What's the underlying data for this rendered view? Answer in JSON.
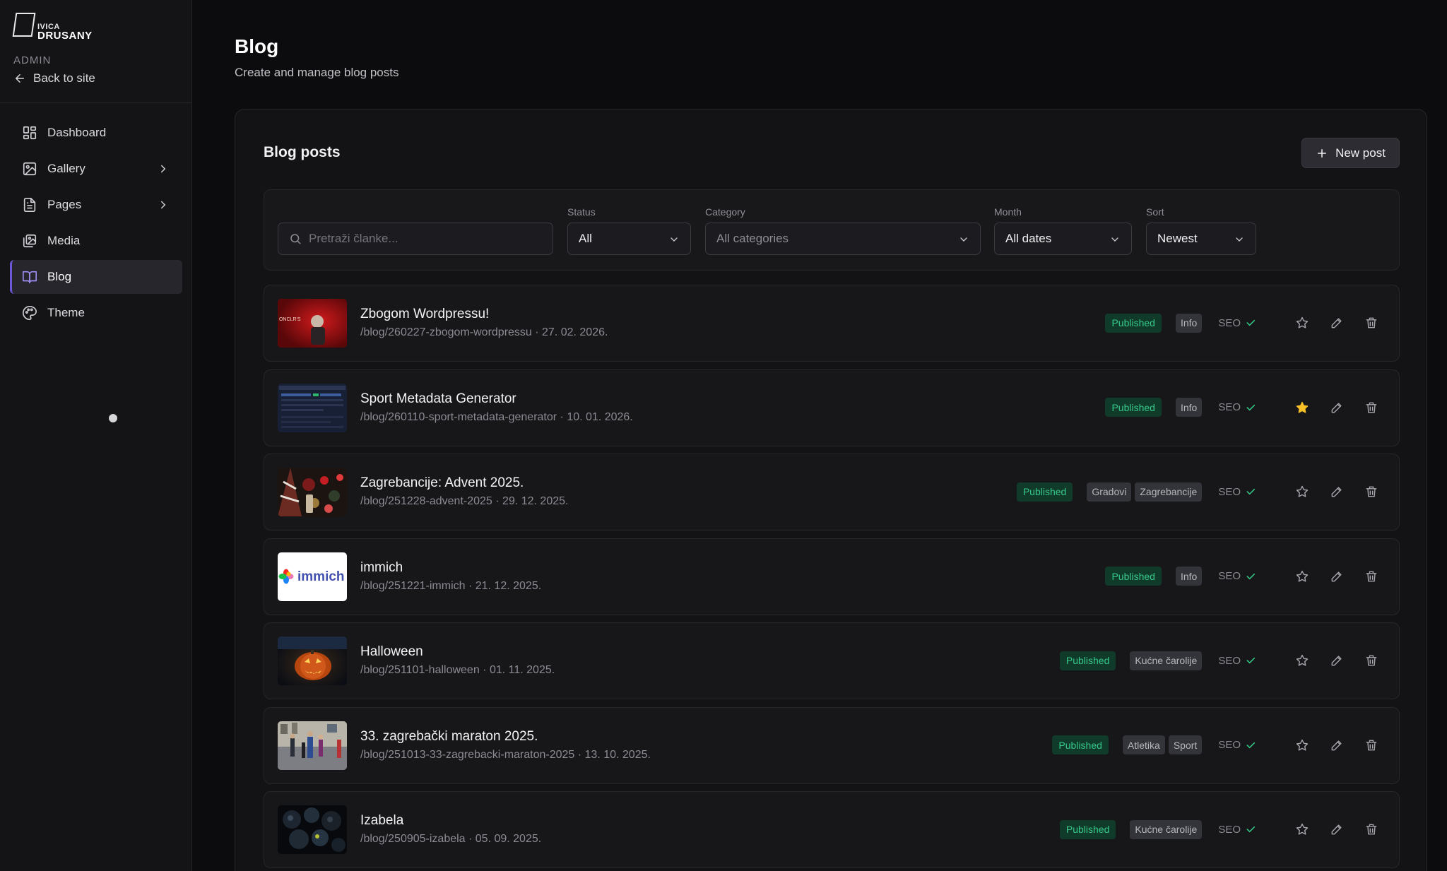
{
  "sidebar": {
    "logo_line1": "IVICA",
    "logo_line2": "DRUSANY",
    "section_label": "ADMIN",
    "back_label": "Back to site",
    "items": [
      {
        "label": "Dashboard",
        "icon": "dashboard-icon",
        "active": false,
        "has_submenu": false
      },
      {
        "label": "Gallery",
        "icon": "image-icon",
        "active": false,
        "has_submenu": true
      },
      {
        "label": "Pages",
        "icon": "file-icon",
        "active": false,
        "has_submenu": true
      },
      {
        "label": "Media",
        "icon": "images-icon",
        "active": false,
        "has_submenu": false
      },
      {
        "label": "Blog",
        "icon": "book-icon",
        "active": true,
        "has_submenu": false
      },
      {
        "label": "Theme",
        "icon": "palette-icon",
        "active": false,
        "has_submenu": false
      }
    ]
  },
  "header": {
    "title": "Blog",
    "subtitle": "Create and manage blog posts"
  },
  "card": {
    "title": "Blog posts",
    "new_post_label": "New post"
  },
  "filters": {
    "search_placeholder": "Pretraži članke...",
    "status": {
      "label": "Status",
      "value": "All"
    },
    "category": {
      "label": "Category",
      "value": "All categories"
    },
    "month": {
      "label": "Month",
      "value": "All dates"
    },
    "sort": {
      "label": "Sort",
      "value": "Newest"
    }
  },
  "posts": [
    {
      "title": "Zbogom Wordpressu!",
      "slug": "/blog/260227-zbogom-wordpressu",
      "date": "27. 02. 2026.",
      "status": "Published",
      "categories": [
        "Info"
      ],
      "seo": "SEO",
      "featured": false
    },
    {
      "title": "Sport Metadata Generator",
      "slug": "/blog/260110-sport-metadata-generator",
      "date": "10. 01. 2026.",
      "status": "Published",
      "categories": [
        "Info"
      ],
      "seo": "SEO",
      "featured": true
    },
    {
      "title": "Zagrebancije: Advent 2025.",
      "slug": "/blog/251228-advent-2025",
      "date": "29. 12. 2025.",
      "status": "Published",
      "categories": [
        "Gradovi",
        "Zagrebancije"
      ],
      "seo": "SEO",
      "featured": false
    },
    {
      "title": "immich",
      "slug": "/blog/251221-immich",
      "date": "21. 12. 2025.",
      "status": "Published",
      "categories": [
        "Info"
      ],
      "seo": "SEO",
      "featured": false
    },
    {
      "title": "Halloween",
      "slug": "/blog/251101-halloween",
      "date": "01. 11. 2025.",
      "status": "Published",
      "categories": [
        "Kućne čarolije"
      ],
      "seo": "SEO",
      "featured": false
    },
    {
      "title": "33. zagrebački maraton 2025.",
      "slug": "/blog/251013-33-zagrebacki-maraton-2025",
      "date": "13. 10. 2025.",
      "status": "Published",
      "categories": [
        "Atletika",
        "Sport"
      ],
      "seo": "SEO",
      "featured": false
    },
    {
      "title": "Izabela",
      "slug": "/blog/250905-izabela",
      "date": "05. 09. 2025.",
      "status": "Published",
      "categories": [
        "Kućne čarolije"
      ],
      "seo": "SEO",
      "featured": false
    }
  ],
  "thumb_texts": {
    "immich": "immich",
    "wordpress": "ONCLR'S"
  },
  "colors": {
    "accent": "#6e57d6",
    "published_bg": "#103b2a",
    "published_text": "#36c98a",
    "featured_star": "#f6c026",
    "background": "#0c0c0e"
  }
}
